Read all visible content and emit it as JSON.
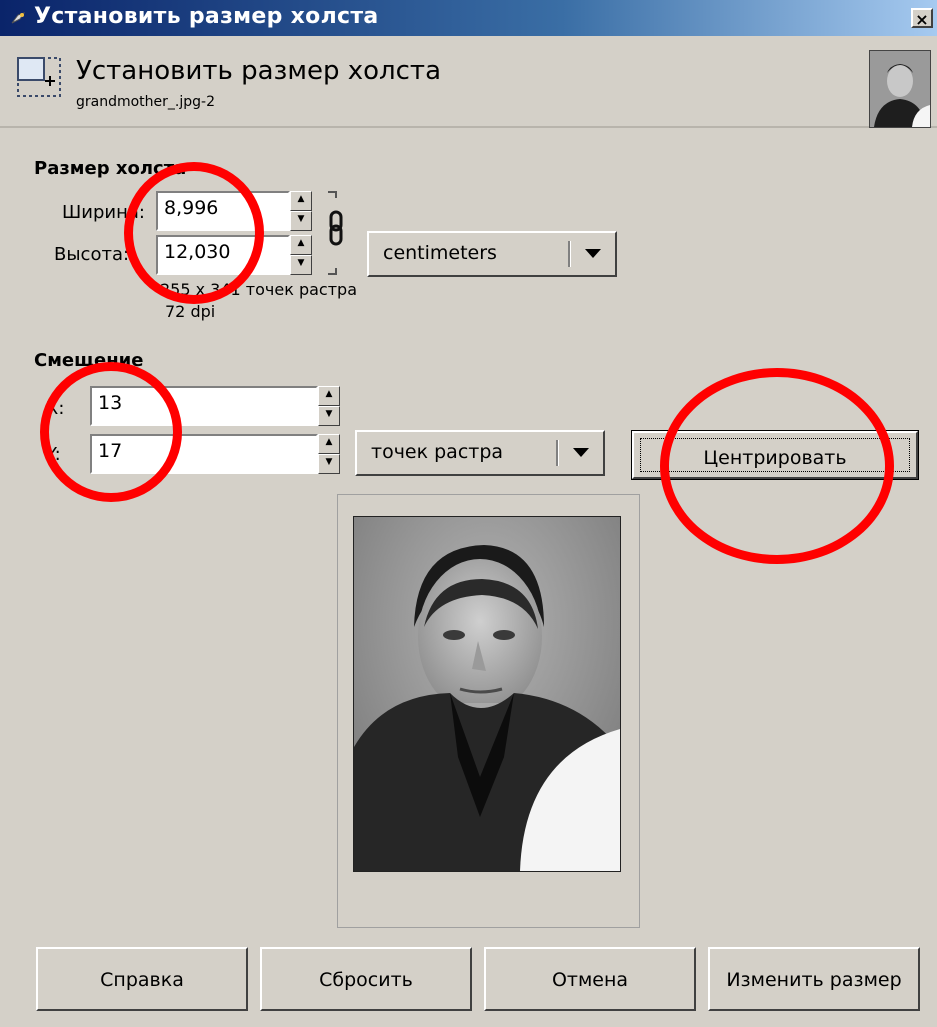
{
  "window": {
    "title": "Установить размер холста",
    "close_label": "×"
  },
  "header": {
    "title": "Установить размер холста",
    "subtitle": "grandmother_.jpg-2"
  },
  "canvas_size": {
    "section_title": "Размер холста",
    "width_label": "Ширина:",
    "width_value": "8,996",
    "height_label": "Высота:",
    "height_value": "12,030",
    "unit": "centimeters",
    "pixel_info": "255 x 341 точек растра",
    "dpi_info": "72 dpi"
  },
  "offset": {
    "section_title": "Смещение",
    "x_label": "X:",
    "x_value": "13",
    "y_label": "Y:",
    "y_value": "17",
    "unit": "точек растра",
    "center_button": "Центрировать"
  },
  "buttons": {
    "help": "Справка",
    "reset": "Сбросить",
    "cancel": "Отмена",
    "resize": "Изменить размер"
  },
  "colors": {
    "annotation": "#ff0000",
    "titlebar_start": "#0a246a",
    "titlebar_end": "#a6caf0",
    "dialog_bg": "#d4d0c8"
  }
}
